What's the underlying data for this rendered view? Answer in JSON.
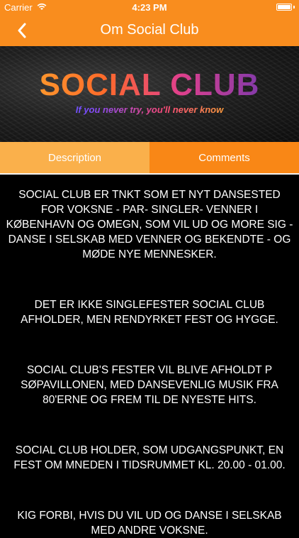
{
  "status_bar": {
    "carrier": "Carrier",
    "time": "4:23 PM"
  },
  "nav": {
    "title": "Om Social Club"
  },
  "banner": {
    "logo_text": "SOCIAL CLUB",
    "tagline": "If you never try, you'll never know"
  },
  "tabs": [
    {
      "label": "Description"
    },
    {
      "label": "Comments"
    }
  ],
  "content": {
    "paragraphs": [
      "SOCIAL CLUB ER TNKT SOM ET NYT DANSESTED FOR VOKSNE - PAR- SINGLER- VENNER I KØBENHAVN OG OMEGN, SOM VIL UD OG MORE SIG - DANSE I SELSKAB MED VENNER OG BEKENDTE - OG MØDE NYE MENNESKER.",
      "DET ER IKKE SINGLEFESTER SOCIAL CLUB AFHOLDER, MEN RENDYRKET FEST OG HYGGE.",
      "SOCIAL CLUB'S FESTER VIL BLIVE AFHOLDT P SØPAVILLONEN, MED DANSEVENLIG MUSIK FRA 80'ERNE OG FREM TIL DE NYESTE HITS.",
      "SOCIAL CLUB HOLDER, SOM UDGANGSPUNKT, EN FEST OM MNEDEN I TIDSRUMMET KL. 20.00 - 01.00.",
      "KIG FORBI, HVIS DU VIL UD OG DANSE I SELSKAB MED ANDRE VOKSNE."
    ]
  }
}
